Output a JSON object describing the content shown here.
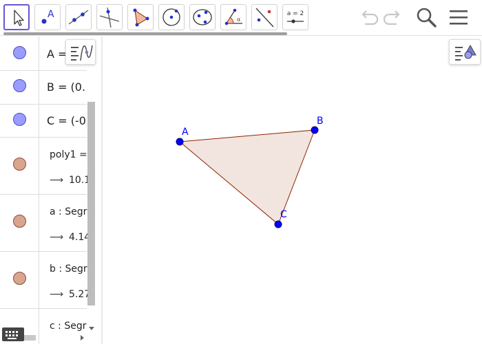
{
  "toolbar": {
    "tools": [
      {
        "name": "move-tool",
        "selected": true
      },
      {
        "name": "point-tool"
      },
      {
        "name": "line-tool"
      },
      {
        "name": "perpendicular-line-tool"
      },
      {
        "name": "polygon-tool"
      },
      {
        "name": "circle-with-center-tool"
      },
      {
        "name": "conic-through-points-tool"
      },
      {
        "name": "angle-tool"
      },
      {
        "name": "reflect-tool"
      },
      {
        "name": "slider-tool",
        "label": "a = 2"
      }
    ],
    "undo_icon": "undo-icon",
    "redo_icon": "redo-icon",
    "search_icon": "search-icon",
    "menu_icon": "menu-icon"
  },
  "algebra": {
    "rows": [
      {
        "type": "point",
        "text": "A = "
      },
      {
        "type": "point",
        "text": "B = (0."
      },
      {
        "type": "point",
        "text": "C = (-0"
      },
      {
        "type": "poly",
        "text": "poly1 =",
        "arrow": "⟶",
        "value": "10.1"
      },
      {
        "type": "poly",
        "text": "a : Segr",
        "arrow": "⟶",
        "value": "4.14"
      },
      {
        "type": "poly",
        "text": "b : Segr",
        "arrow": "⟶",
        "value": "5.27"
      },
      {
        "type": "poly",
        "text": "c : Segr"
      }
    ]
  },
  "graphics": {
    "points": [
      {
        "label": "A"
      },
      {
        "label": "B"
      },
      {
        "label": "C"
      }
    ],
    "colors": {
      "point": "#0000ff",
      "polygon_fill": "#f2e4de",
      "polygon_stroke": "#8b2500",
      "accent": "#6557d2",
      "point_marble": "#9a9cff",
      "poly_marble": "#d9a58f"
    }
  }
}
